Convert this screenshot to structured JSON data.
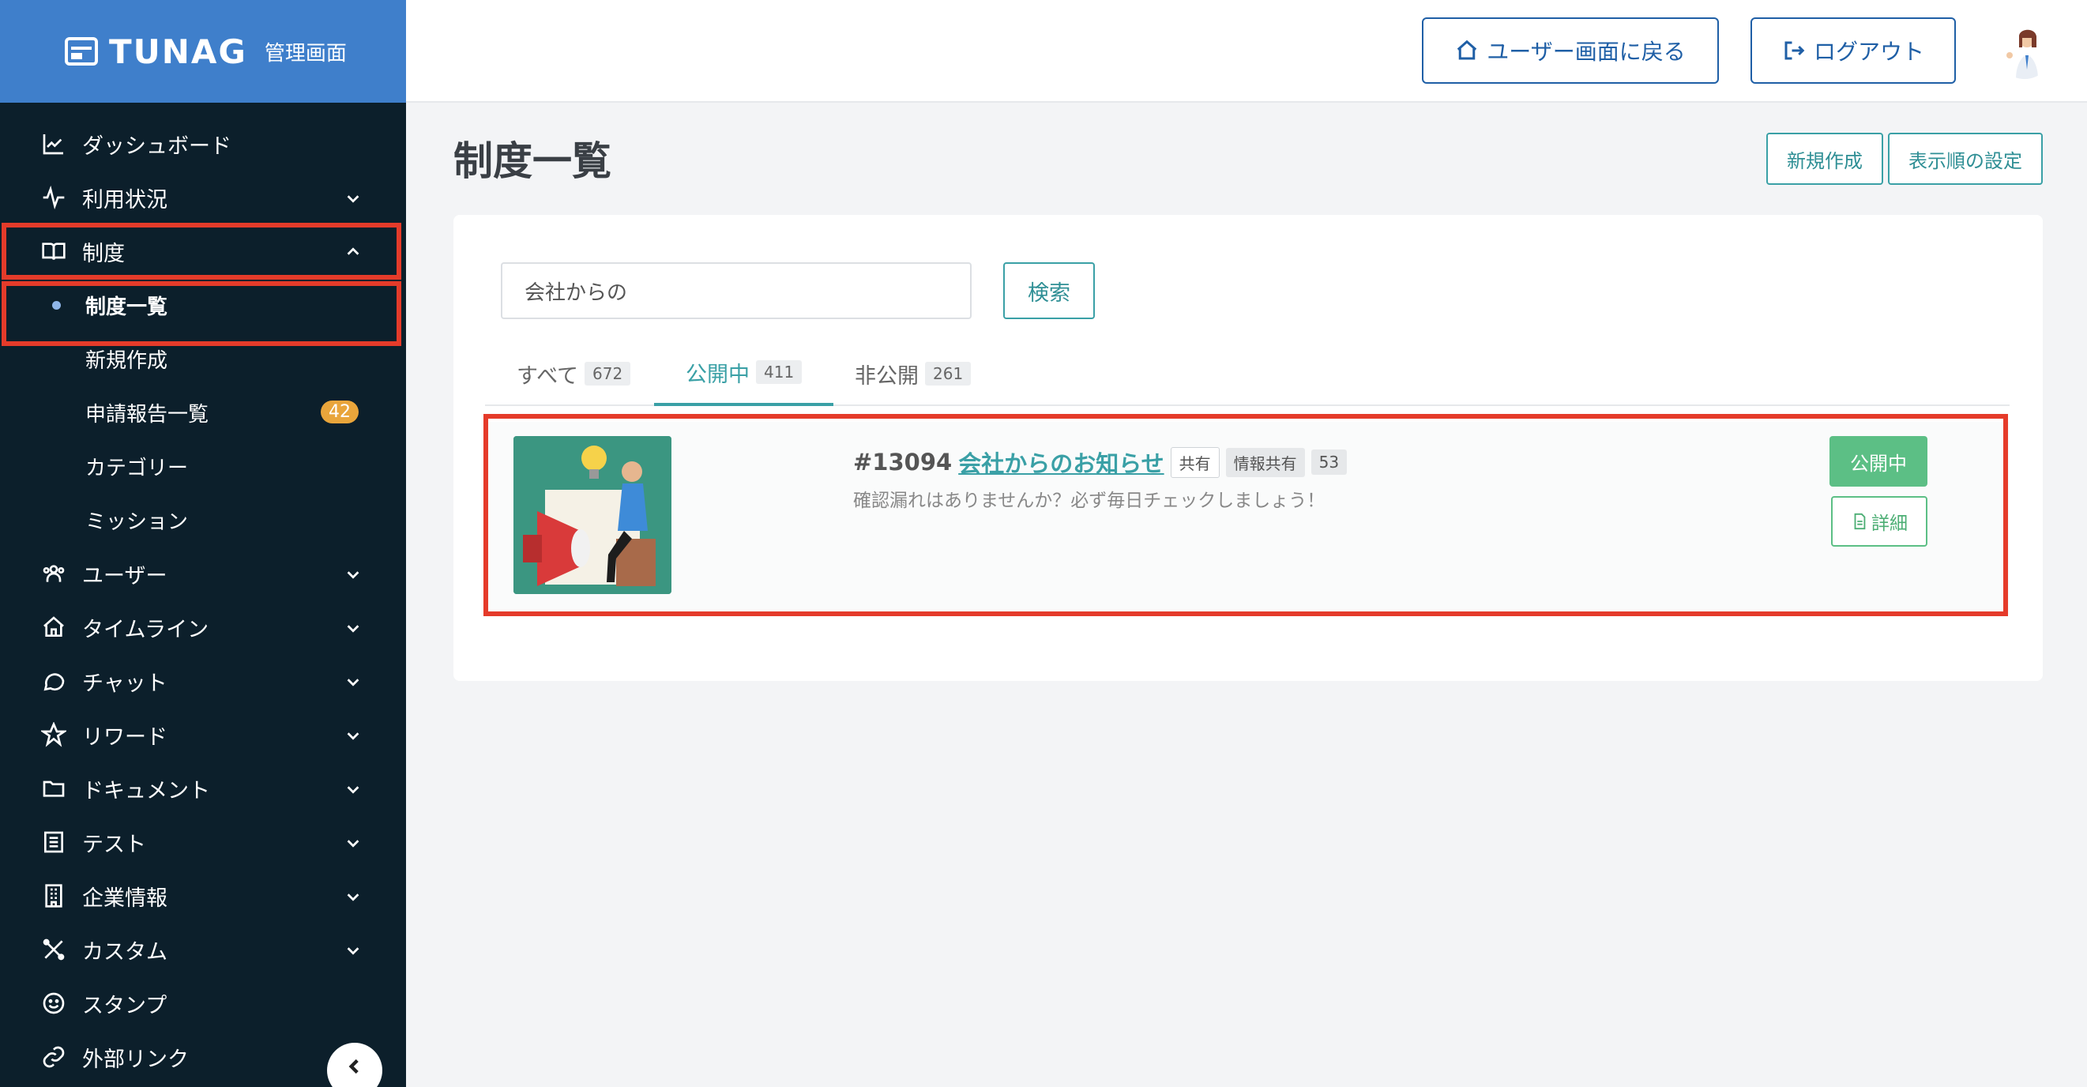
{
  "brand": {
    "logo": "TUNAG",
    "subtitle": "管理画面"
  },
  "sidebar": {
    "items": [
      {
        "label": "ダッシュボード",
        "icon": "chart-line-icon",
        "expandable": false
      },
      {
        "label": "利用状況",
        "icon": "activity-icon",
        "expandable": true
      },
      {
        "label": "制度",
        "icon": "book-icon",
        "expandable": true,
        "expanded": true
      },
      {
        "label": "ユーザー",
        "icon": "users-icon",
        "expandable": true
      },
      {
        "label": "タイムライン",
        "icon": "home-icon",
        "expandable": true
      },
      {
        "label": "チャット",
        "icon": "chat-icon",
        "expandable": true
      },
      {
        "label": "リワード",
        "icon": "star-icon",
        "expandable": true
      },
      {
        "label": "ドキュメント",
        "icon": "folder-icon",
        "expandable": true
      },
      {
        "label": "テスト",
        "icon": "checklist-icon",
        "expandable": true
      },
      {
        "label": "企業情報",
        "icon": "building-icon",
        "expandable": true
      },
      {
        "label": "カスタム",
        "icon": "tools-icon",
        "expandable": true
      },
      {
        "label": "スタンプ",
        "icon": "smile-icon",
        "expandable": false
      },
      {
        "label": "外部リンク",
        "icon": "link-icon",
        "expandable": false
      }
    ],
    "sub_items": [
      {
        "label": "制度一覧",
        "active": true
      },
      {
        "label": "新規作成"
      },
      {
        "label": "申請報告一覧",
        "badge": "42"
      },
      {
        "label": "カテゴリー"
      },
      {
        "label": "ミッション"
      }
    ]
  },
  "header": {
    "back_button": "ユーザー画面に戻る",
    "logout_button": "ログアウト"
  },
  "main": {
    "title": "制度一覧",
    "new_button": "新規作成",
    "order_button": "表示順の設定",
    "search": {
      "value": "会社からの",
      "button": "検索"
    },
    "tabs": [
      {
        "label": "すべて",
        "count": "672"
      },
      {
        "label": "公開中",
        "count": "411",
        "active": true
      },
      {
        "label": "非公開",
        "count": "261"
      }
    ],
    "rows": [
      {
        "id": "#13094",
        "title": "会社からのお知らせ",
        "tags": [
          "共有",
          "情報共有",
          "53"
        ],
        "description": "確認漏れはありませんか？必ず毎日チェックしましょう！",
        "status": "公開中",
        "detail_button": "詳細"
      }
    ]
  },
  "colors": {
    "brand_blue": "#3f7fcb",
    "sidebar_bg": "#0c1f2b",
    "teal": "#3aa0a6",
    "green": "#5cbf85",
    "highlight_red": "#e53b2a",
    "badge_orange": "#e9a53b"
  }
}
